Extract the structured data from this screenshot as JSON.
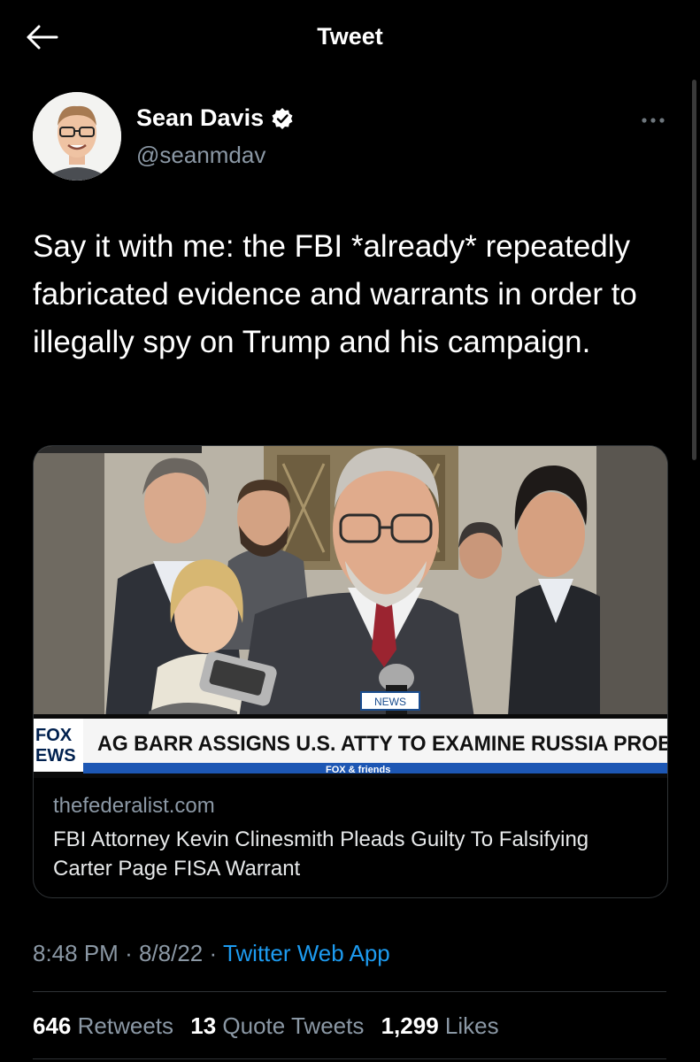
{
  "header": {
    "title": "Tweet"
  },
  "author": {
    "name": "Sean Davis",
    "handle": "@seanmdav",
    "verified": true
  },
  "tweet": {
    "text": "Say it with me: the FBI *already* repeatedly fabricated evidence and warrants in order to illegally spy on Trump and his campaign."
  },
  "card": {
    "image": {
      "logo_line1": "FOX",
      "logo_line2": "EWS",
      "chyron": "AG BARR ASSIGNS U.S. ATTY TO EXAMINE RUSSIA PROB",
      "show_name": "FOX & friends",
      "mic_flag": "NEWS"
    },
    "domain": "thefederalist.com",
    "title": "FBI Attorney Kevin Clinesmith Pleads Guilty To Falsifying Carter Page FISA Warrant"
  },
  "meta": {
    "time": "8:48 PM",
    "separator": "·",
    "date": "8/8/22",
    "app": "Twitter Web App"
  },
  "stats": {
    "retweets_count": "646",
    "retweets_label": "Retweets",
    "quotes_count": "13",
    "quotes_label": "Quote Tweets",
    "likes_count": "1,299",
    "likes_label": "Likes"
  },
  "colors": {
    "background": "#000000",
    "text_primary": "#ffffff",
    "text_secondary": "#8b98a5",
    "accent": "#1d9bf0",
    "divider": "#2f3336"
  }
}
